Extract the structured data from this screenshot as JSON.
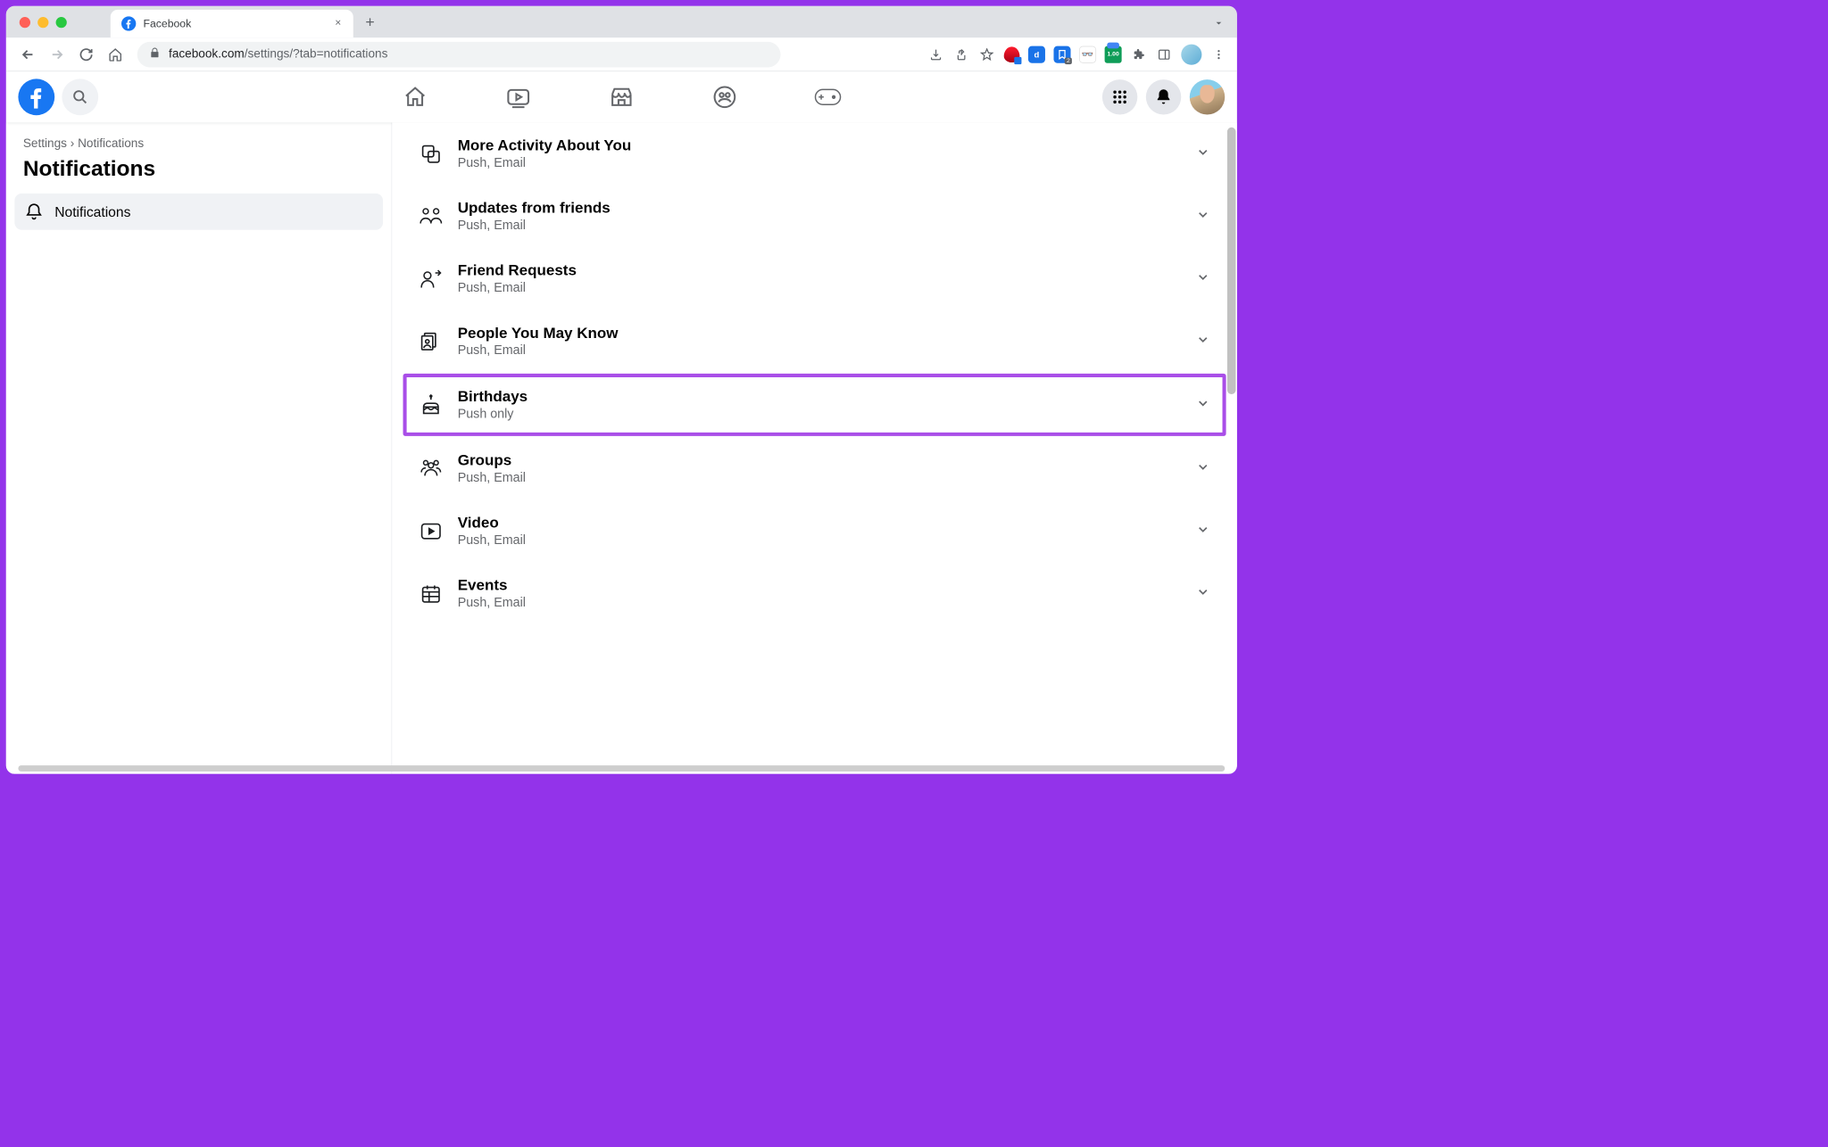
{
  "browser": {
    "tab_title": "Facebook",
    "url_domain": "facebook.com",
    "url_path": "/settings/?tab=notifications",
    "ext_green_label": "1.00"
  },
  "breadcrumb": "Settings › Notifications",
  "page_title": "Notifications",
  "sidebar": {
    "item_label": "Notifications"
  },
  "rows": [
    {
      "title": "More Activity About You",
      "sub": "Push, Email"
    },
    {
      "title": "Updates from friends",
      "sub": "Push, Email"
    },
    {
      "title": "Friend Requests",
      "sub": "Push, Email"
    },
    {
      "title": "People You May Know",
      "sub": "Push, Email"
    },
    {
      "title": "Birthdays",
      "sub": "Push only"
    },
    {
      "title": "Groups",
      "sub": "Push, Email"
    },
    {
      "title": "Video",
      "sub": "Push, Email"
    },
    {
      "title": "Events",
      "sub": "Push, Email"
    }
  ]
}
